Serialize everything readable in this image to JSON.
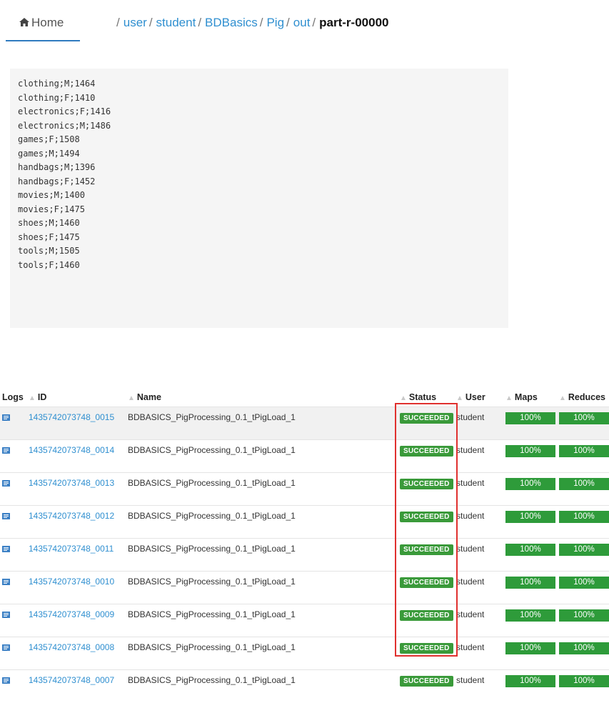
{
  "nav": {
    "home_label": "Home",
    "breadcrumb": [
      "user",
      "student",
      "BDBasics",
      "Pig",
      "out"
    ],
    "current": "part-r-00000"
  },
  "file_lines": [
    "clothing;M;1464",
    "clothing;F;1410",
    "electronics;F;1416",
    "electronics;M;1486",
    "games;F;1508",
    "games;M;1494",
    "handbags;M;1396",
    "handbags;F;1452",
    "movies;M;1400",
    "movies;F;1475",
    "shoes;M;1460",
    "shoes;F;1475",
    "tools;M;1505",
    "tools;F;1460"
  ],
  "table": {
    "headers": {
      "logs": "Logs",
      "id": "ID",
      "name": "Name",
      "status": "Status",
      "user": "User",
      "maps": "Maps",
      "reduces": "Reduces"
    },
    "rows": [
      {
        "id": "1435742073748_0015",
        "name": "BDBASICS_PigProcessing_0.1_tPigLoad_1",
        "status": "SUCCEEDED",
        "user": "student",
        "maps": "100%",
        "maps_progress": 1.0,
        "reduces": "100%",
        "reduces_progress": 1.0
      },
      {
        "id": "1435742073748_0014",
        "name": "BDBASICS_PigProcessing_0.1_tPigLoad_1",
        "status": "SUCCEEDED",
        "user": "student",
        "maps": "100%",
        "maps_progress": 1.0,
        "reduces": "100%",
        "reduces_progress": 1.0
      },
      {
        "id": "1435742073748_0013",
        "name": "BDBASICS_PigProcessing_0.1_tPigLoad_1",
        "status": "SUCCEEDED",
        "user": "student",
        "maps": "100%",
        "maps_progress": 1.0,
        "reduces": "100%",
        "reduces_progress": 1.0
      },
      {
        "id": "1435742073748_0012",
        "name": "BDBASICS_PigProcessing_0.1_tPigLoad_1",
        "status": "SUCCEEDED",
        "user": "student",
        "maps": "100%",
        "maps_progress": 1.0,
        "reduces": "100%",
        "reduces_progress": 1.0
      },
      {
        "id": "1435742073748_0011",
        "name": "BDBASICS_PigProcessing_0.1_tPigLoad_1",
        "status": "SUCCEEDED",
        "user": "student",
        "maps": "100%",
        "maps_progress": 1.0,
        "reduces": "100%",
        "reduces_progress": 1.0
      },
      {
        "id": "1435742073748_0010",
        "name": "BDBASICS_PigProcessing_0.1_tPigLoad_1",
        "status": "SUCCEEDED",
        "user": "student",
        "maps": "100%",
        "maps_progress": 1.0,
        "reduces": "100%",
        "reduces_progress": 1.0
      },
      {
        "id": "1435742073748_0009",
        "name": "BDBASICS_PigProcessing_0.1_tPigLoad_1",
        "status": "SUCCEEDED",
        "user": "student",
        "maps": "100%",
        "maps_progress": 1.0,
        "reduces": "100%",
        "reduces_progress": 1.0
      },
      {
        "id": "1435742073748_0008",
        "name": "BDBASICS_PigProcessing_0.1_tPigLoad_1",
        "status": "SUCCEEDED",
        "user": "student",
        "maps": "100%",
        "maps_progress": 1.0,
        "reduces": "100%",
        "reduces_progress": 1.0
      },
      {
        "id": "1435742073748_0007",
        "name": "BDBASICS_PigProcessing_0.1_tPigLoad_1",
        "status": "SUCCEEDED",
        "user": "student",
        "maps": "100%",
        "maps_progress": 1.0,
        "reduces": "100%",
        "reduces_progress": 1.0
      }
    ]
  },
  "colors": {
    "link": "#2f8fd0",
    "success": "#3a9a3a",
    "progress_fill": "#2e9b3a",
    "highlight": "#e0302e"
  },
  "icons": {
    "home": "home-icon",
    "logs": "log-file-icon",
    "sort": "sort-icon"
  }
}
